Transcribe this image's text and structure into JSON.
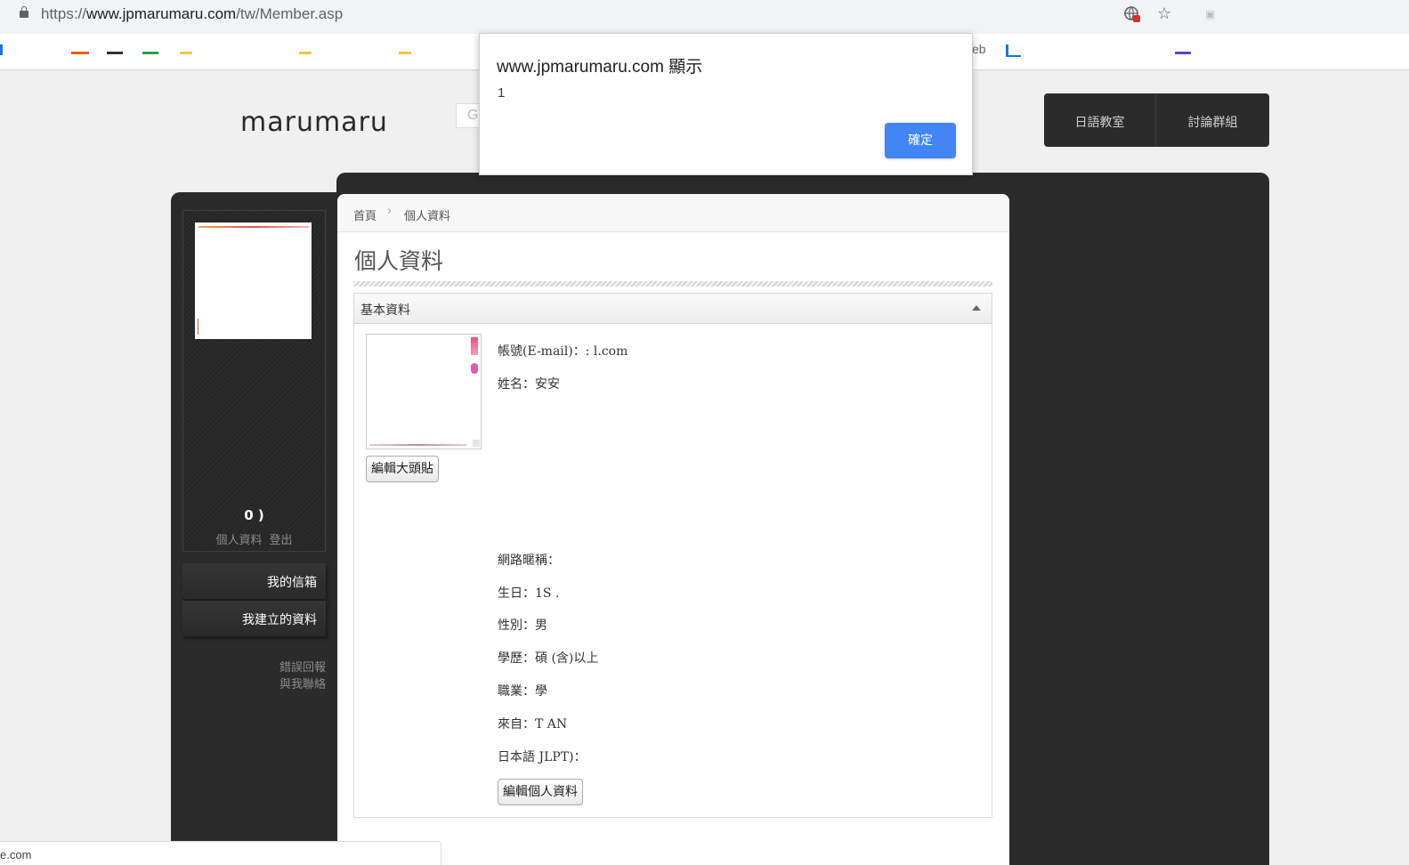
{
  "browser": {
    "url_prefix": "https://",
    "url_host": "www.jpmarumaru.com",
    "url_path": "/tw/Member.asp",
    "bookmark_fragments": [
      "eb"
    ]
  },
  "site": {
    "logo": "marumaru",
    "search_stub": "G",
    "nav": [
      "日語教室",
      "討論群組"
    ]
  },
  "sidebar": {
    "points": "0 )",
    "links": [
      "個人資料",
      "登出"
    ],
    "menu": [
      "我的信箱",
      "我建立的資料"
    ],
    "footer": [
      "錯誤回報",
      "與我聯絡"
    ]
  },
  "main": {
    "breadcrumb": [
      "首頁",
      "個人資料"
    ],
    "breadcrumb_sep": "›",
    "title": "個人資料",
    "card_title": "基本資料",
    "edit_avatar_button": "編輯大頭貼",
    "fields": [
      {
        "label": "帳號(E-mail)：",
        "value": ":                          l.com"
      },
      {
        "label": "姓名：",
        "value": "安安"
      },
      {
        "label": "網路暱稱：",
        "value": ""
      },
      {
        "label": "生日：",
        "value": "1S          ."
      },
      {
        "label": "性別：",
        "value": "男"
      },
      {
        "label": "學歷：",
        "value": "碩      (含)以上"
      },
      {
        "label": "職業：",
        "value": "學"
      },
      {
        "label": "來自：",
        "value": "T      AN"
      },
      {
        "label": "日本語",
        "value": "      JLPT)："
      }
    ],
    "edit_profile_button": "編輯個人資料"
  },
  "statusbar": {
    "text": "e.com"
  },
  "dialog": {
    "title": "www.jpmarumaru.com 顯示",
    "message": "1",
    "ok_label": "確定"
  }
}
